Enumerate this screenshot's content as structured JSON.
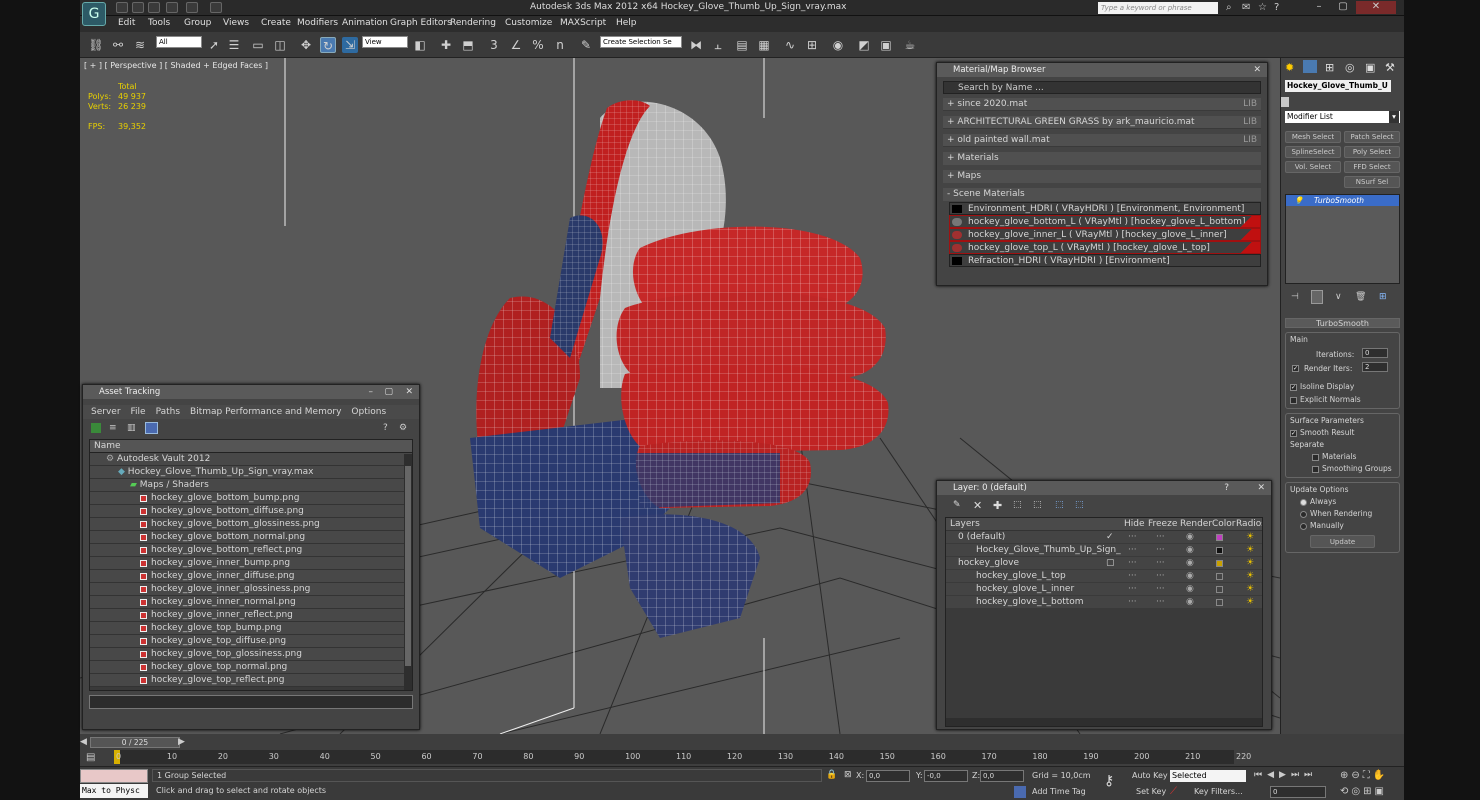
{
  "app": {
    "title": "Autodesk 3ds Max  2012 x64      Hockey_Glove_Thumb_Up_Sign_vray.max",
    "search_placeholder": "Type a keyword or phrase",
    "logo_glyph": "G"
  },
  "menu": [
    "Edit",
    "Tools",
    "Group",
    "Views",
    "Create",
    "Modifiers",
    "Animation",
    "Graph Editors",
    "Rendering",
    "Customize",
    "MAXScript",
    "Help"
  ],
  "toolbar": {
    "selection_filter": "All",
    "ref_coord": "View",
    "named_selection": "Create Selection Se",
    "snap_3": "3",
    "snap_pct": "%",
    "snap_n": "n"
  },
  "viewport": {
    "label": "[ + ] [ Perspective ] [ Shaded + Edged Faces ]",
    "stats": {
      "total_label": "Total",
      "polys_label": "Polys:",
      "polys": "49 937",
      "verts_label": "Verts:",
      "verts": "26 239",
      "fps_label": "FPS:",
      "fps": "39,352"
    }
  },
  "material_browser": {
    "title": "Material/Map Browser",
    "search": "Search by Name ...",
    "rows": [
      {
        "text": "+ since 2020.mat",
        "tag": "LIB"
      },
      {
        "text": "+ ARCHITECTURAL GREEN GRASS by ark_mauricio.mat",
        "tag": "LIB"
      },
      {
        "text": "+ old painted wall.mat",
        "tag": "LIB"
      },
      {
        "text": "+ Materials",
        "tag": ""
      },
      {
        "text": "+ Maps",
        "tag": ""
      },
      {
        "text": "- Scene Materials",
        "tag": ""
      }
    ],
    "scene": [
      {
        "text": "Environment_HDRI  ( VRayHDRI ) [Environment, Environment]",
        "red": false
      },
      {
        "text": "hockey_glove_bottom_L  ( VRayMtl ) [hockey_glove_L_bottom]",
        "red": true
      },
      {
        "text": "hockey_glove_inner_L  ( VRayMtl ) [hockey_glove_L_inner]",
        "red": true
      },
      {
        "text": "hockey_glove_top_L  ( VRayMtl ) [hockey_glove_L_top]",
        "red": true
      },
      {
        "text": "Refraction_HDRI  ( VRayHDRI ) [Environment]",
        "red": false
      }
    ]
  },
  "asset_tracking": {
    "title": "Asset Tracking",
    "menu": [
      "Server",
      "File",
      "Paths",
      "Bitmap Performance and Memory",
      "Options"
    ],
    "column": "Name",
    "vault": "Autodesk Vault 2012",
    "file": "Hockey_Glove_Thumb_Up_Sign_vray.max",
    "maps_folder": "Maps / Shaders",
    "maps": [
      "hockey_glove_bottom_bump.png",
      "hockey_glove_bottom_diffuse.png",
      "hockey_glove_bottom_glossiness.png",
      "hockey_glove_bottom_normal.png",
      "hockey_glove_bottom_reflect.png",
      "hockey_glove_inner_bump.png",
      "hockey_glove_inner_diffuse.png",
      "hockey_glove_inner_glossiness.png",
      "hockey_glove_inner_normal.png",
      "hockey_glove_inner_reflect.png",
      "hockey_glove_top_bump.png",
      "hockey_glove_top_diffuse.png",
      "hockey_glove_top_glossiness.png",
      "hockey_glove_top_normal.png",
      "hockey_glove_top_reflect.png"
    ]
  },
  "layers": {
    "title": "Layer: 0 (default)",
    "help": "?",
    "columns": [
      "Layers",
      "Hide",
      "Freeze",
      "Render",
      "Color",
      "Radiosity"
    ],
    "items": [
      {
        "name": "0 (default)",
        "color": "#c040c0",
        "check": "✓"
      },
      {
        "name": "Hockey_Glove_Thumb_Up_Sign_",
        "color": "#111111",
        "check": ""
      },
      {
        "name": "hockey_glove",
        "color": "#c8a000",
        "check": "▢"
      },
      {
        "name": "hockey_glove_L_top",
        "color": "#444444",
        "check": ""
      },
      {
        "name": "hockey_glove_L_inner",
        "color": "#444444",
        "check": ""
      },
      {
        "name": "hockey_glove_L_bottom",
        "color": "#444444",
        "check": ""
      }
    ]
  },
  "command_panel": {
    "object_name": "Hockey_Glove_Thumb_U",
    "modifier_list": "Modifier List",
    "buttons": [
      "Mesh Select",
      "Patch Select",
      "SplineSelect",
      "Poly Select",
      "Vol. Select",
      "FFD Select",
      "NSurf Sel"
    ],
    "stack_item": "TurboSmooth",
    "rollout": "TurboSmooth",
    "main": "Main",
    "iterations_label": "Iterations:",
    "iterations": "0",
    "render_iters_label": "Render Iters:",
    "render_iters": "2",
    "isoline": "Isoline Display",
    "explicit": "Explicit Normals",
    "surface": "Surface Parameters",
    "smooth": "Smooth Result",
    "separate": "Separate",
    "materials": "Materials",
    "smoothing": "Smoothing Groups",
    "update_options": "Update Options",
    "always": "Always",
    "when_rendering": "When Rendering",
    "manually": "Manually",
    "update": "Update"
  },
  "timeline": {
    "frame": "0 / 225",
    "ticks": [
      "0",
      "10",
      "20",
      "30",
      "40",
      "50",
      "60",
      "70",
      "80",
      "90",
      "100",
      "110",
      "120",
      "130",
      "140",
      "150",
      "160",
      "170",
      "180",
      "190",
      "200",
      "210",
      "220"
    ]
  },
  "status": {
    "maxscript": "Max to Physc",
    "selected": "1 Group Selected",
    "prompt": "Click and drag to select and rotate objects",
    "x_label": "X:",
    "x": "0,0",
    "y_label": "Y:",
    "y": "-0,0",
    "z_label": "Z:",
    "z": "0,0",
    "grid": "Grid = 10,0cm",
    "add_time_tag": "Add Time Tag",
    "auto_key": "Auto Key",
    "selected_dd": "Selected",
    "set_key": "Set Key",
    "key_filters": "Key Filters...",
    "frame_field": "0"
  }
}
